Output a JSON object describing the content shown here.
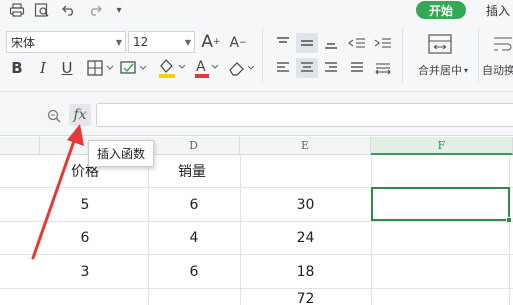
{
  "ribbon": {
    "tabs": {
      "start": "开始",
      "insert": "插入"
    },
    "font": {
      "name": "宋体",
      "size": "12"
    },
    "icons": {
      "print": "printer-icon",
      "preview": "print-preview-icon",
      "undo": "undo-icon",
      "redo": "redo-icon",
      "customize": "chevron-down-icon",
      "grow": "font-grow-icon",
      "shrink": "font-shrink-icon",
      "bold": "B",
      "italic": "I",
      "underline": "U",
      "border": "border-icon",
      "fill": "fill-color-icon",
      "font_color": "font-color-icon",
      "clear": "eraser-icon",
      "align": "align-icons",
      "merge": "merge-center-icon",
      "wrap": "wrap-text-icon"
    },
    "merge_label": "合并居中",
    "wrap_label": "自动换",
    "accent_color": "#34a853",
    "font_color_swatch": "#e53935",
    "fill_color_swatch": "#f5d20a"
  },
  "formula_bar": {
    "fx_label": "fx",
    "value": ""
  },
  "tooltip": {
    "text": "插入函数"
  },
  "grid": {
    "columns": [
      "C",
      "D",
      "E",
      "F"
    ],
    "active_column": "F",
    "header_row": [
      "价格",
      "销量",
      "",
      ""
    ],
    "rows": [
      [
        "5",
        "6",
        "30",
        ""
      ],
      [
        "6",
        "4",
        "24",
        ""
      ],
      [
        "3",
        "6",
        "18",
        ""
      ],
      [
        "",
        "",
        "72",
        ""
      ]
    ],
    "selection_color": "#2e8b47"
  },
  "annotation": {
    "arrow_color": "#e53935"
  }
}
